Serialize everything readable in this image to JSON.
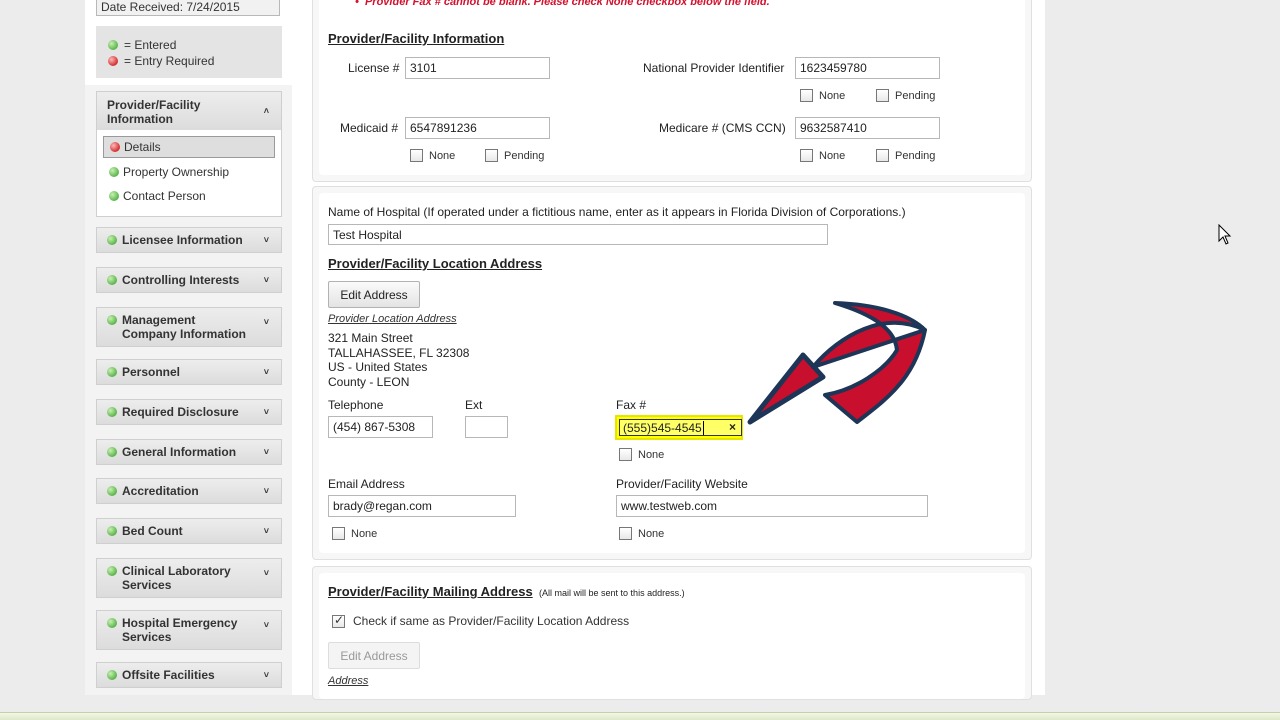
{
  "sidebar": {
    "date_received": "Date Received: 7/24/2015",
    "legend": {
      "entered": "= Entered",
      "required": "= Entry Required"
    },
    "open_section": {
      "title": "Provider/Facility Information",
      "items": [
        {
          "label": "Details",
          "status": "required"
        },
        {
          "label": "Property Ownership",
          "status": "entered"
        },
        {
          "label": "Contact Person",
          "status": "entered"
        }
      ]
    },
    "sections": [
      {
        "label": "Licensee Information"
      },
      {
        "label": "Controlling Interests"
      },
      {
        "label": "Management Company Information"
      },
      {
        "label": "Personnel"
      },
      {
        "label": "Required Disclosure"
      },
      {
        "label": "General Information"
      },
      {
        "label": "Accreditation"
      },
      {
        "label": "Bed Count"
      },
      {
        "label": "Clinical Laboratory Services"
      },
      {
        "label": "Hospital Emergency Services"
      },
      {
        "label": "Offsite Facilities"
      }
    ]
  },
  "provider_info": {
    "error": "Provider Fax # cannot be blank. Please check None checkbox below the field.",
    "title": "Provider/Facility Information",
    "license_label": "License #",
    "license_value": "3101",
    "npi_label": "National Provider Identifier",
    "npi_value": "1623459780",
    "medicaid_label": "Medicaid #",
    "medicaid_value": "6547891236",
    "medicare_label": "Medicare # (CMS CCN)",
    "medicare_value": "9632587410",
    "none": "None",
    "pending": "Pending"
  },
  "location": {
    "hospital_name_label": "Name of Hospital (If operated under a fictitious name, enter as it appears in Florida Division of Corporations.)",
    "hospital_name_value": "Test Hospital",
    "title": "Provider/Facility Location Address",
    "edit_button": "Edit Address",
    "address_caption": "Provider Location Address",
    "address_lines": [
      "321 Main Street",
      "TALLAHASSEE, FL 32308",
      "US - United States",
      "County - LEON"
    ],
    "telephone_label": "Telephone",
    "telephone_value": "(454) 867-5308",
    "ext_label": "Ext",
    "ext_value": "",
    "fax_label": "Fax #",
    "fax_value": "(555)545-4545",
    "fax_clear": "×",
    "email_label": "Email Address",
    "email_value": "brady@regan.com",
    "website_label": "Provider/Facility Website",
    "website_value": "www.testweb.com",
    "none": "None"
  },
  "mailing": {
    "title": "Provider/Facility Mailing Address",
    "note": "(All mail will be sent to this address.)",
    "same_as_label": "Check if same as Provider/Facility Location Address",
    "same_as_checked": true,
    "edit_button": "Edit Address",
    "address_caption": "Address"
  },
  "colors": {
    "error_red": "#d2122e",
    "highlight_yellow": "#ffff00",
    "arrow_red": "#c8102e",
    "arrow_navy": "#1d3557"
  },
  "icons": {
    "cursor": "mouse-pointer-icon",
    "arrow": "annotation-arrow-icon"
  }
}
